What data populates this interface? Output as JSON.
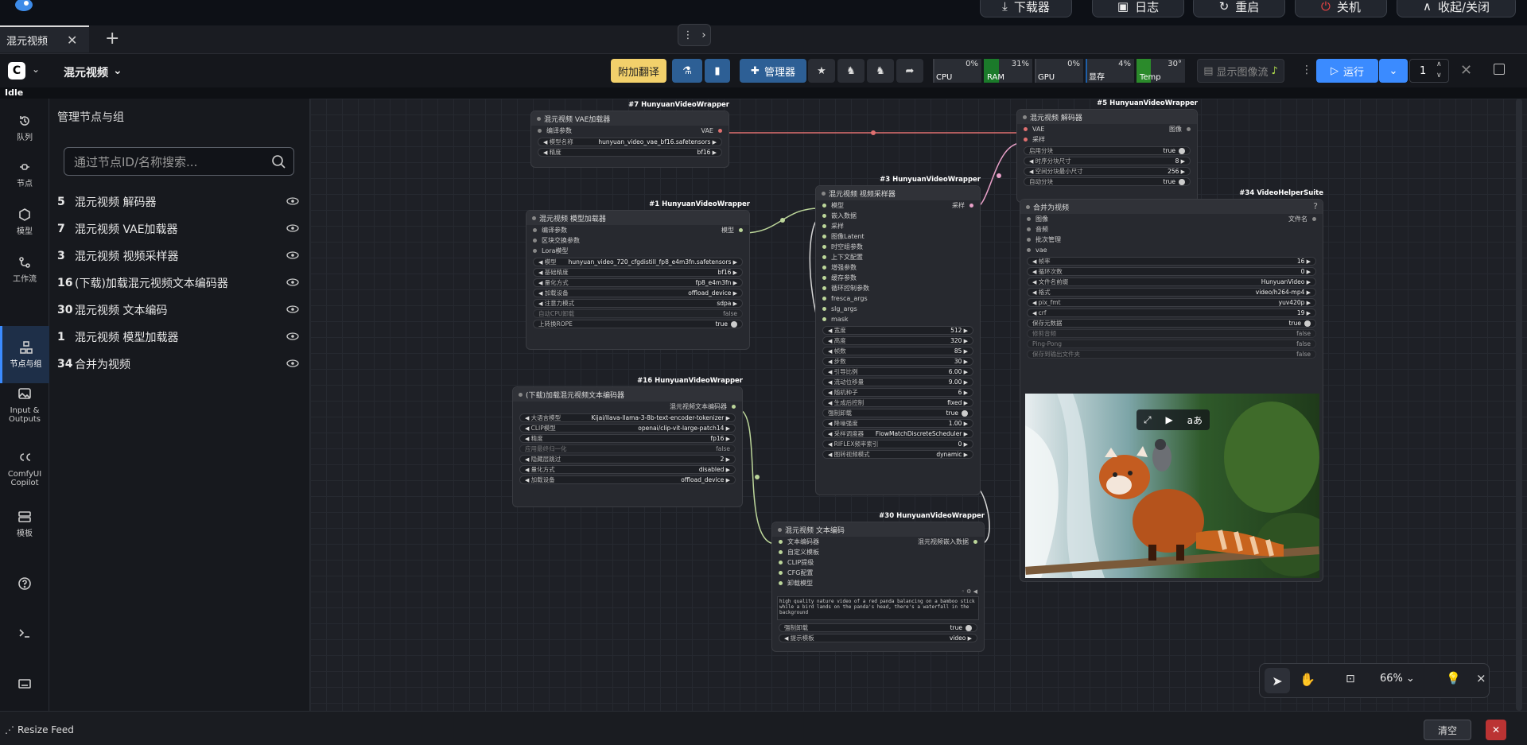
{
  "top_buttons": [
    {
      "label": "下载器",
      "icon": "download-icon"
    },
    {
      "label": "日志",
      "icon": "terminal-icon"
    },
    {
      "label": "重启",
      "icon": "refresh-icon"
    },
    {
      "label": "关机",
      "icon": "power-icon"
    },
    {
      "label": "收起/关闭",
      "icon": "chevron-up-icon"
    }
  ],
  "tabs": [
    {
      "label": "混元视频"
    }
  ],
  "workflow_name": "混元视频",
  "menu": {
    "translate": "附加翻译",
    "manager": "管理器",
    "show_image_stream": "显示图像流",
    "run": "运行",
    "batch_count": "1"
  },
  "monitor": [
    {
      "label": "CPU",
      "value": "0%",
      "color": "#3a3d44",
      "fill": 0.0
    },
    {
      "label": "RAM",
      "value": "31%",
      "color": "#1b7a2a",
      "fill": 0.31
    },
    {
      "label": "GPU",
      "value": "0%",
      "color": "#3a3d44",
      "fill": 0.0
    },
    {
      "label": "显存",
      "value": "4%",
      "color": "#1f5fa8",
      "fill": 0.04
    },
    {
      "label": "Temp",
      "value": "30°",
      "color": "#2b8a2b",
      "fill": 0.3
    }
  ],
  "status": "Idle",
  "rail": [
    {
      "label": "队列",
      "icon": "history-icon"
    },
    {
      "label": "节点",
      "icon": "node-icon"
    },
    {
      "label": "模型",
      "icon": "model-icon"
    },
    {
      "label": "工作流",
      "icon": "workflow-icon"
    },
    {
      "label": "节点与组",
      "icon": "node-group-icon",
      "active": true
    },
    {
      "label": "Input & Outputs",
      "icon": "image-icon"
    },
    {
      "label": "ComfyUI Copilot",
      "icon": "copilot-icon"
    },
    {
      "label": "模板",
      "icon": "template-icon"
    }
  ],
  "panel": {
    "title": "管理节点与组",
    "search_placeholder": "通过节点ID/名称搜索...",
    "items": [
      {
        "id": "5",
        "label": "混元视频 解码器"
      },
      {
        "id": "7",
        "label": "混元视频 VAE加载器"
      },
      {
        "id": "3",
        "label": "混元视频 视频采样器"
      },
      {
        "id": "16",
        "label": "(下载)加载混元视频文本编码器"
      },
      {
        "id": "30",
        "label": "混元视频 文本编码"
      },
      {
        "id": "1",
        "label": "混元视频 模型加载器"
      },
      {
        "id": "34",
        "label": "合并为视频"
      }
    ]
  },
  "nodes": {
    "vae_loader": {
      "tag": "#7 HunyuanVideoWrapper",
      "title": "混元视频 VAE加载器",
      "in": "编译参数",
      "out": "VAE",
      "widgets": [
        {
          "l": "模型名称",
          "v": "hunyuan_video_vae_bf16.safetensors"
        },
        {
          "l": "精度",
          "v": "bf16"
        }
      ]
    },
    "model_loader": {
      "tag": "#1 HunyuanVideoWrapper",
      "title": "混元视频 模型加载器",
      "out": "模型",
      "inputs": [
        "编译参数",
        "区块交换参数",
        "Lora模型"
      ],
      "widgets": [
        {
          "l": "模型",
          "v": "hunyuan_video_720_cfgdistill_fp8_e4m3fn.safetensors"
        },
        {
          "l": "基础精度",
          "v": "bf16"
        },
        {
          "l": "量化方式",
          "v": "fp8_e4m3fn"
        },
        {
          "l": "加载设备",
          "v": "offload_device"
        },
        {
          "l": "注意力模式",
          "v": "sdpa"
        },
        {
          "l": "自动CPU卸载",
          "v": "false",
          "dim": true
        },
        {
          "l": "上转换ROPE",
          "v": "true",
          "tog": true
        }
      ]
    },
    "text_encoder_loader": {
      "tag": "#16 HunyuanVideoWrapper",
      "title": "(下载)加载混元视频文本编码器",
      "out": "混元视频文本编码器",
      "widgets": [
        {
          "l": "大语言模型",
          "v": "Kijai/llava-llama-3-8b-text-encoder-tokenizer"
        },
        {
          "l": "CLIP模型",
          "v": "openai/clip-vit-large-patch14"
        },
        {
          "l": "精度",
          "v": "fp16"
        },
        {
          "l": "应用最终归一化",
          "v": "false",
          "dim": true
        },
        {
          "l": "隐藏层跳过",
          "v": "2"
        },
        {
          "l": "量化方式",
          "v": "disabled"
        },
        {
          "l": "加载设备",
          "v": "offload_device"
        }
      ]
    },
    "sampler": {
      "tag": "#3 HunyuanVideoWrapper",
      "title": "混元视频 视频采样器",
      "out": "采样",
      "inputs": [
        "模型",
        "嵌入数据",
        "采样",
        "图像Latent",
        "时空组参数",
        "上下文配置",
        "增强参数",
        "缓存参数",
        "循环控制参数",
        "fresca_args",
        "slg_args",
        "mask"
      ],
      "widgets": [
        {
          "l": "宽度",
          "v": "512"
        },
        {
          "l": "高度",
          "v": "320"
        },
        {
          "l": "帧数",
          "v": "85"
        },
        {
          "l": "步数",
          "v": "30"
        },
        {
          "l": "引导比例",
          "v": "6.00"
        },
        {
          "l": "流动位移量",
          "v": "9.00"
        },
        {
          "l": "随机种子",
          "v": "6"
        },
        {
          "l": "生成后控制",
          "v": "fixed"
        },
        {
          "l": "强制卸载",
          "v": "true",
          "tog": true
        },
        {
          "l": "降噪强度",
          "v": "1.00"
        },
        {
          "l": "采样调度器",
          "v": "FlowMatchDiscreteScheduler"
        },
        {
          "l": "RIFLEX频率索引",
          "v": "0"
        },
        {
          "l": "图转视频模式",
          "v": "dynamic"
        }
      ]
    },
    "decoder": {
      "tag": "#5 HunyuanVideoWrapper",
      "title": "混元视频 解码器",
      "out": "图像",
      "inputs": [
        "VAE",
        "采样"
      ],
      "widgets": [
        {
          "l": "启用分块",
          "v": "true",
          "tog": true
        },
        {
          "l": "时序分块尺寸",
          "v": "8"
        },
        {
          "l": "空间分块最小尺寸",
          "v": "256"
        },
        {
          "l": "自动分块",
          "v": "true",
          "tog": true
        }
      ]
    },
    "combine": {
      "tag": "#34 VideoHelperSuite",
      "title": "合并为视频",
      "out": "文件名",
      "inputs": [
        "图像",
        "音频",
        "批次管理",
        "vae"
      ],
      "widgets": [
        {
          "l": "帧率",
          "v": "16"
        },
        {
          "l": "循环次数",
          "v": "0"
        },
        {
          "l": "文件名前缀",
          "v": "HunyuanVideo"
        },
        {
          "l": "格式",
          "v": "video/h264-mp4"
        },
        {
          "l": "pix_fmt",
          "v": "yuv420p"
        },
        {
          "l": "crf",
          "v": "19"
        },
        {
          "l": "保存元数据",
          "v": "true",
          "tog": true
        },
        {
          "l": "修剪音频",
          "v": "false",
          "dim": true
        },
        {
          "l": "Ping-Pong",
          "v": "false",
          "dim": true
        },
        {
          "l": "保存到输出文件夹",
          "v": "false",
          "dim": true
        }
      ]
    },
    "text_encode": {
      "tag": "#30 HunyuanVideoWrapper",
      "title": "混元视频 文本编码",
      "out": "混元视频嵌入数据",
      "inputs": [
        "文本编码器",
        "自定义模板",
        "CLIP提级",
        "CFG配置",
        "卸载模型"
      ],
      "prompt": "high quality nature video of a red panda balancing on a bamboo stick while a bird lands on the panda's head, there's a waterfall in the background",
      "widgets": [
        {
          "l": "强制卸载",
          "v": "true",
          "tog": true
        },
        {
          "l": "提示模板",
          "v": "video"
        }
      ]
    }
  },
  "zoom": "66%",
  "bottom": {
    "resize": "Resize Feed",
    "clear": "清空"
  }
}
